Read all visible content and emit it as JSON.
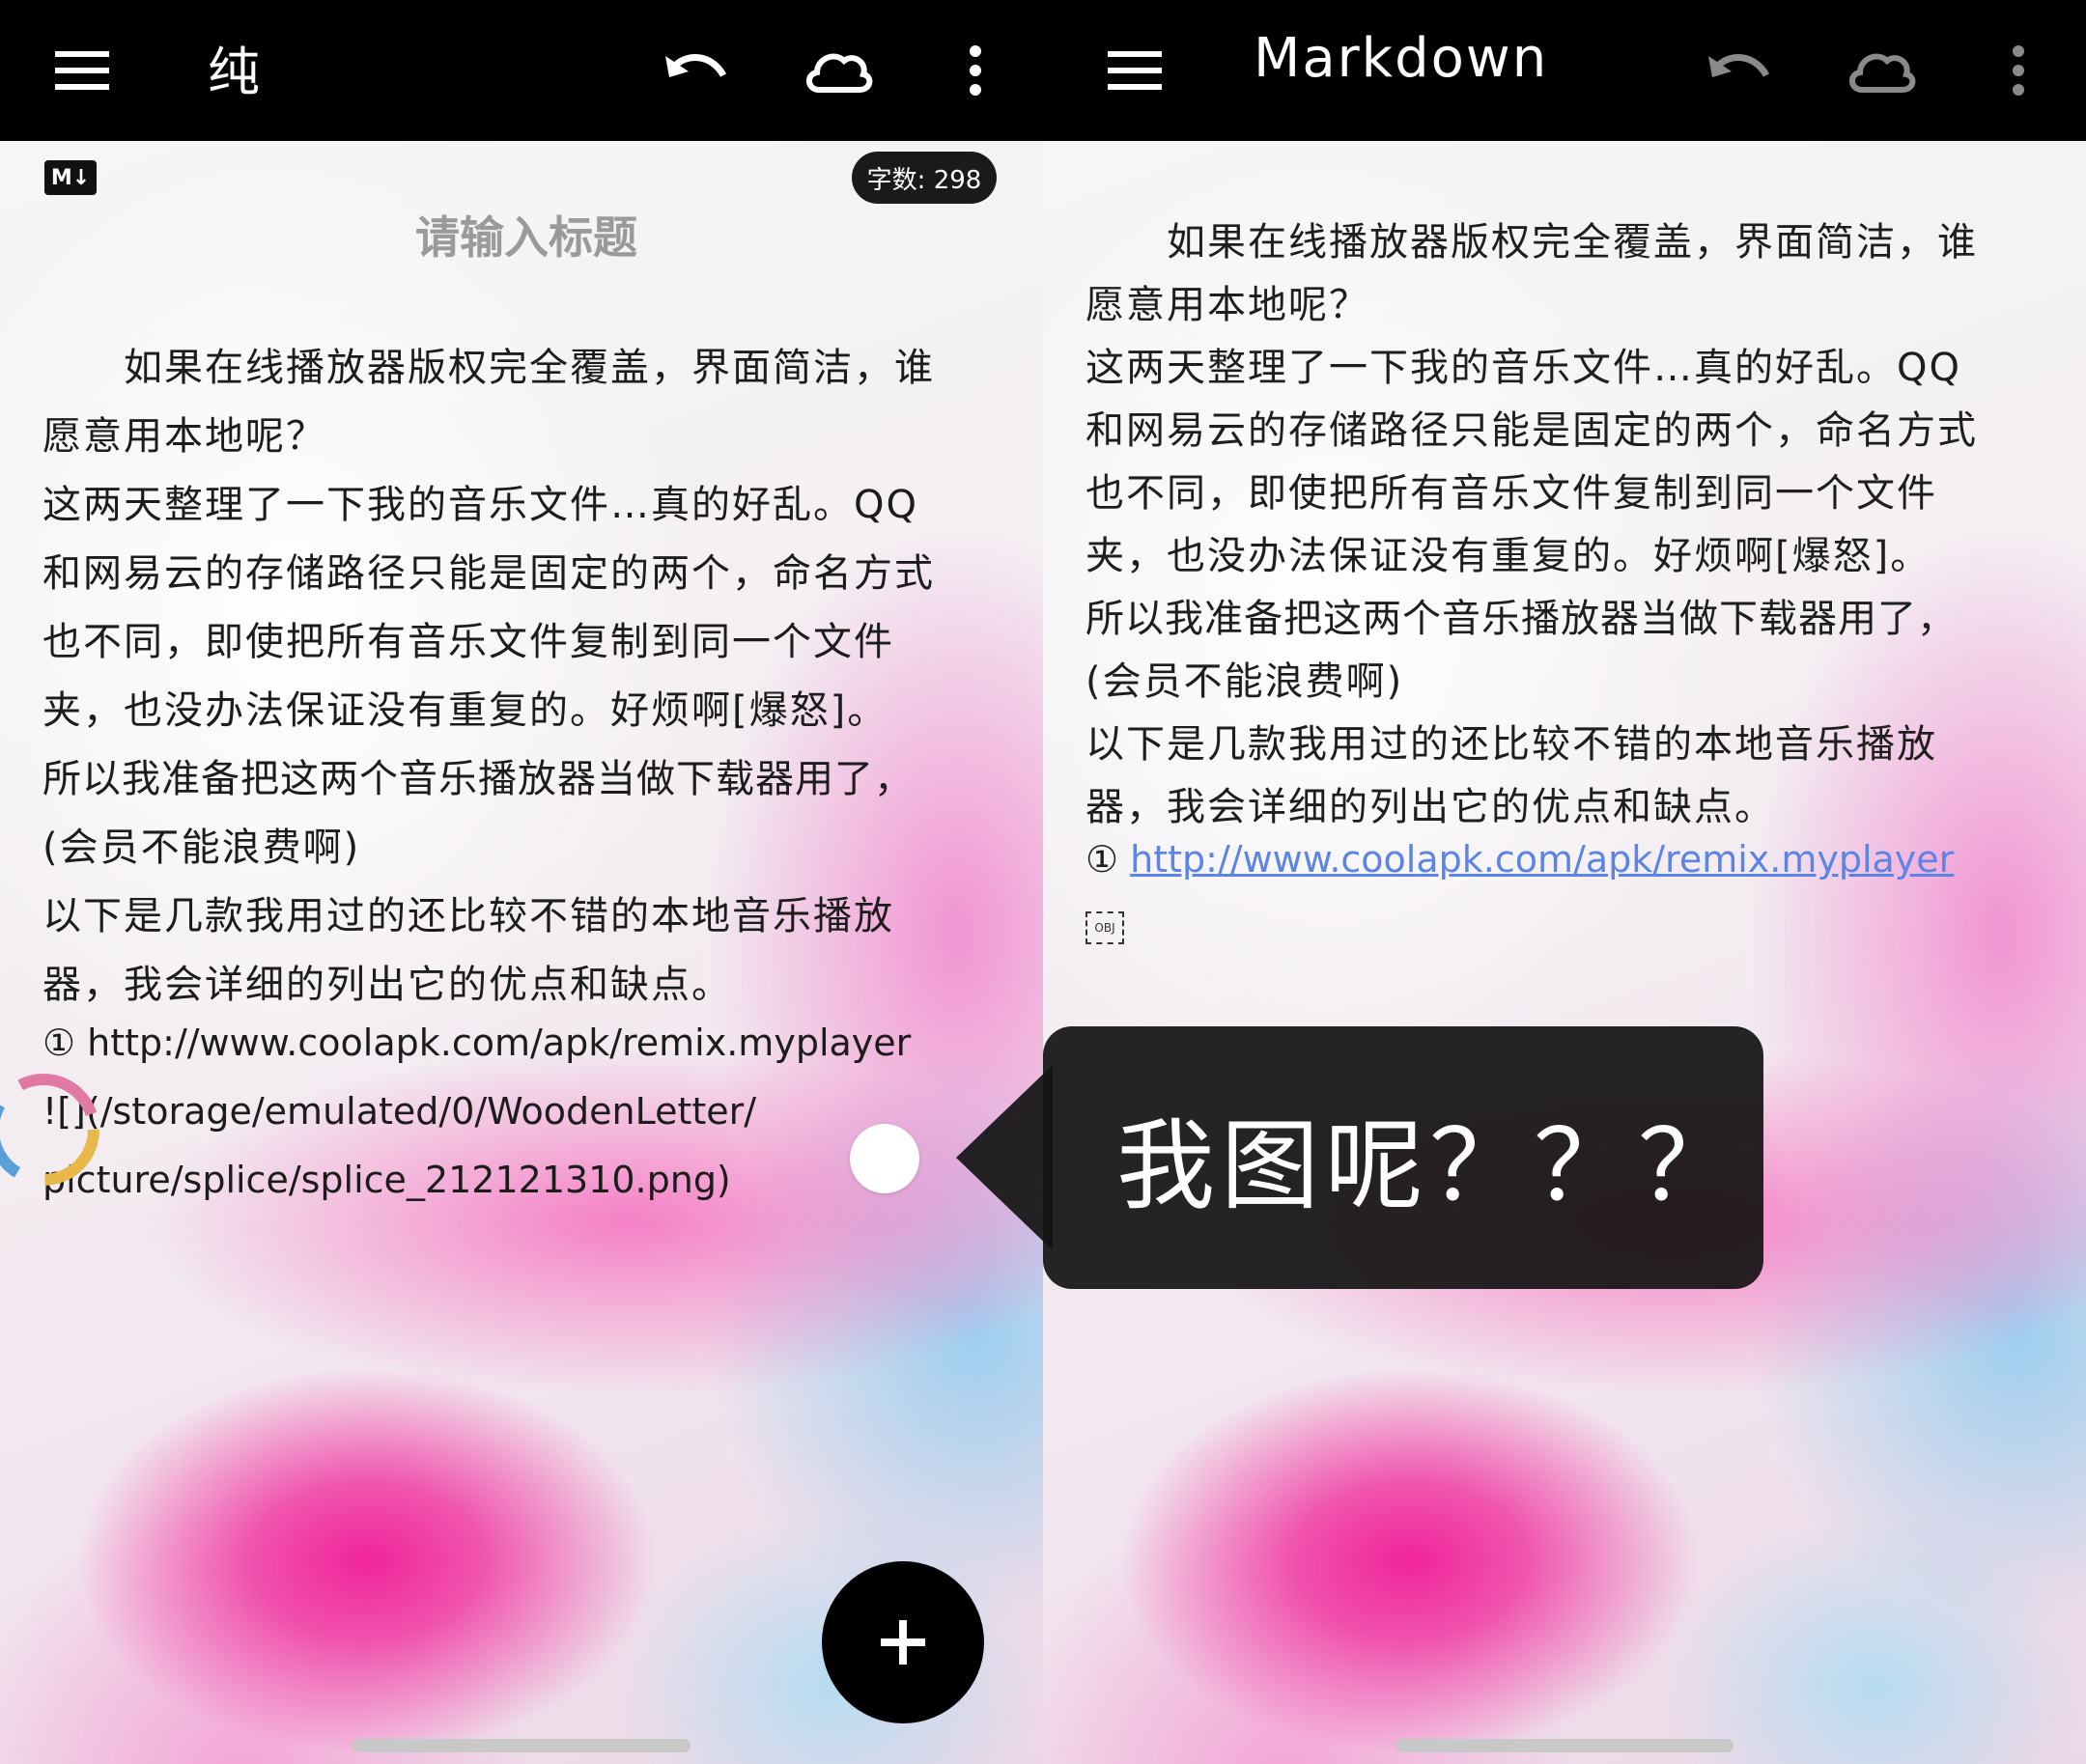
{
  "left": {
    "mode_title": "纯",
    "md_badge": "M↓",
    "word_count": "字数: 298",
    "title_placeholder": "请输入标题",
    "lines": [
      "　　如果在线播放器版权完全覆盖，界面简洁，谁",
      "愿意用本地呢？",
      "这两天整理了一下我的音乐文件…真的好乱。QQ",
      "和网易云的存储路径只能是固定的两个，命名方式",
      "也不同，即使把所有音乐文件复制到同一个文件",
      "夹，也没办法保证没有重复的。好烦啊[爆怒]。",
      "所以我准备把这两个音乐播放器当做下载器用了，",
      "(会员不能浪费啊)",
      "以下是几款我用过的还比较不错的本地音乐播放",
      "器，我会详细的列出它的优点和缺点。",
      "① http://www.coolapk.com/apk/remix.myplayer",
      " ![](/storage/emulated/0/WoodenLetter/",
      "picture/splice/splice_212121310.png)"
    ],
    "fab_label": "+"
  },
  "right": {
    "mode_title": "Markdown",
    "lines": [
      "　　如果在线播放器版权完全覆盖，界面简洁，谁",
      "愿意用本地呢？",
      "这两天整理了一下我的音乐文件…真的好乱。QQ",
      "和网易云的存储路径只能是固定的两个，命名方式",
      "也不同，即使把所有音乐文件复制到同一个文件",
      "夹，也没办法保证没有重复的。好烦啊[爆怒]。",
      "所以我准备把这两个音乐播放器当做下载器用了，",
      "(会员不能浪费啊)",
      "以下是几款我用过的还比较不错的本地音乐播放",
      "器，我会详细的列出它的优点和缺点。"
    ],
    "link_prefix": "①",
    "link_text": "http://www.coolapk.com/apk/remix.myplayer",
    "obj_placeholder": "OBJ"
  },
  "tooltip": "我图呢？？？",
  "colors": {
    "topbar": "#000000",
    "link": "#5b84e6",
    "fab": "#000000",
    "disabled_icon": "#8a8a8a"
  }
}
